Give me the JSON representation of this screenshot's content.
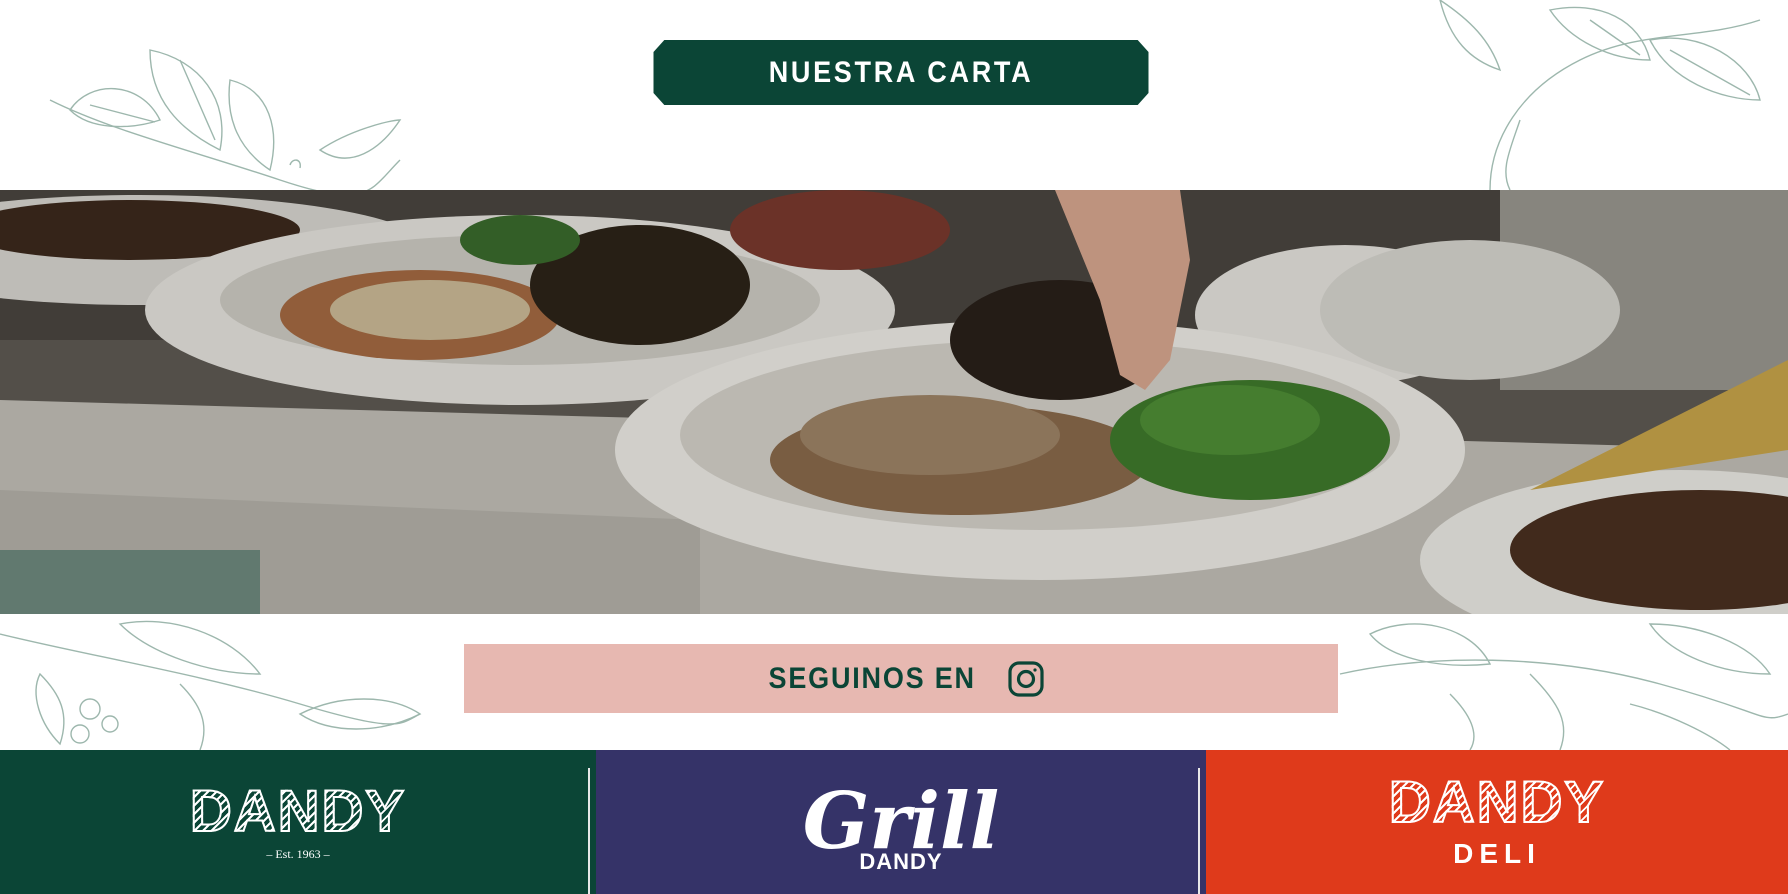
{
  "menu_section": {
    "carta_label": "NUESTRA CARTA"
  },
  "hero": {
    "image_name": "restaurant-dishes-photo"
  },
  "social": {
    "follow_label": "SEGUINOS EN",
    "icon": "instagram-icon"
  },
  "brands": [
    {
      "name": "DANDY",
      "tagline": "– Est. 1963 –",
      "color": "#0b4536"
    },
    {
      "name": "Grill",
      "subname": "DANDY",
      "color": "#353368"
    },
    {
      "name": "DANDY",
      "subname": "DELI",
      "color": "#df3a1b"
    }
  ],
  "colors": {
    "primary_green": "#0b4536",
    "grill_purple": "#353368",
    "deli_red": "#df3a1b",
    "follow_pink": "#e7b8b1"
  }
}
